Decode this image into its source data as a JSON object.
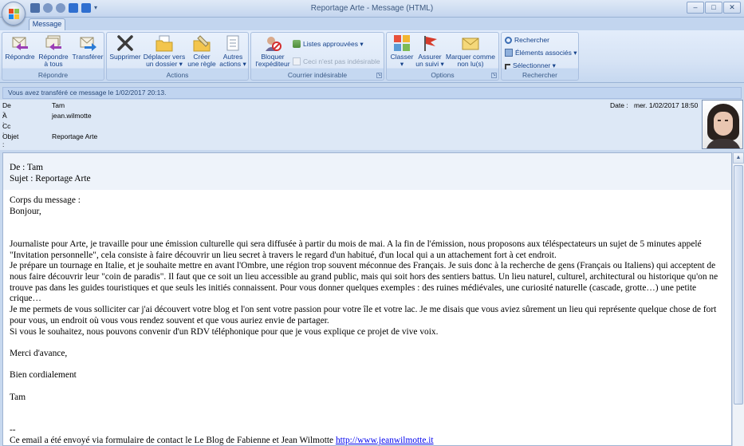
{
  "window": {
    "title": "Reportage Arte - Message (HTML)",
    "controls": [
      "–",
      "□",
      "✕"
    ]
  },
  "tabs": {
    "message": "Message"
  },
  "ribbon": {
    "groups": {
      "repondre": "Répondre",
      "actions": "Actions",
      "courrier": "Courrier indésirable",
      "options": "Options",
      "rechercher": "Rechercher"
    },
    "buttons": {
      "reply": "Répondre",
      "reply_all_1": "Répondre",
      "reply_all_2": "à tous",
      "forward": "Transférer",
      "delete": "Supprimer",
      "move_1": "Déplacer vers",
      "move_2": "un dossier ▾",
      "rule_1": "Créer",
      "rule_2": "une règle",
      "other_1": "Autres",
      "other_2": "actions ▾",
      "block_1": "Bloquer",
      "block_2": "l'expéditeur",
      "approved": "Listes approuvées ▾",
      "not_junk": "Ceci n'est pas indésirable",
      "classify_1": "Classer",
      "classify_2": "▾",
      "followup_1": "Assurer",
      "followup_2": "un suivi ▾",
      "mark_1": "Marquer comme",
      "mark_2": "non lu(s)",
      "search": "Rechercher",
      "related": "Éléments associés ▾",
      "select": "Sélectionner ▾"
    },
    "colors": {
      "accent": "#15428b",
      "ribbon_bg": "#d6e3f5"
    }
  },
  "infobar": "Vous avez transféré ce message le 1/02/2017 20:13.",
  "header": {
    "from_label": "De :",
    "from_value": "Tam",
    "to_label": "À :",
    "to_value": "jean.wilmotte",
    "cc_label": "Cc :",
    "cc_value": "",
    "subject_label": "Objet :",
    "subject_value": "Reportage Arte",
    "date_label": "Date :",
    "date_value": "mer. 1/02/2017 18:50"
  },
  "body": {
    "lines": [
      "De : Tam",
      "Sujet : Reportage Arte",
      "",
      "Corps du message :",
      "Bonjour,",
      "",
      "",
      "Journaliste pour Arte, je travaille pour une émission culturelle qui sera diffusée à partir du mois de mai. A la fin de l'émission, nous proposons aux téléspectateurs un sujet de 5 minutes appelé \"Invitation personnelle\", cela consiste à faire découvrir un lieu secret à travers le regard d'un habitué, d'un local qui a un attachement fort à cet endroit.",
      "Je prépare un tournage en Italie, et je souhaite mettre en avant l'Ombre, une région trop souvent méconnue des Français. Je suis donc à la recherche de gens (Français ou Italiens) qui acceptent de nous faire découvrir leur \"coin de paradis\". Il faut que ce soit un lieu accessible au grand public, mais qui soit hors des sentiers battus. Un lieu naturel, culturel, architectural ou historique qu'on ne trouve pas dans les guides touristiques et que seuls les initiés connaissent. Pour vous donner quelques exemples : des ruines médiévales, une curiosité naturelle (cascade, grotte…) une petite crique…",
      "Je me permets de vous solliciter car j'ai découvert votre blog et l'on sent votre passion pour votre île et votre lac. Je me disais que vous aviez sûrement un lieu qui représente quelque chose de fort pour vous, un endroit où vous vous rendez souvent et que vous auriez envie de partager.",
      "Si vous le souhaitez, nous pouvons convenir d'un RDV téléphonique pour que je vous explique ce projet de vive voix.",
      "",
      "Merci d'avance,",
      "",
      "Bien cordialement",
      "",
      "Tam",
      "",
      "",
      "--"
    ],
    "footer_text": "Ce email a été envoyé via formulaire de contact le Le Blog de Fabienne et Jean Wilmotte ",
    "footer_link": "http://www.jeanwilmotte.it"
  }
}
